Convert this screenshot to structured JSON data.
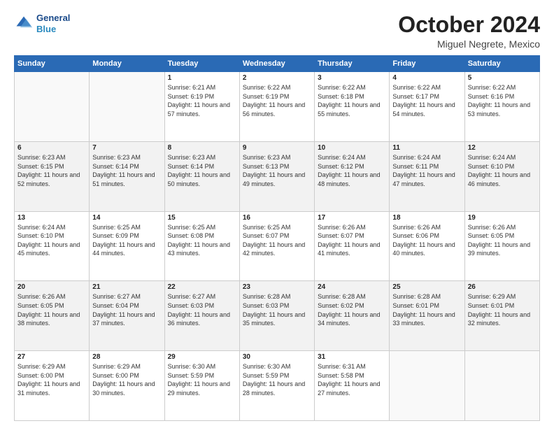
{
  "header": {
    "logo_line1": "General",
    "logo_line2": "Blue",
    "month": "October 2024",
    "location": "Miguel Negrete, Mexico"
  },
  "weekdays": [
    "Sunday",
    "Monday",
    "Tuesday",
    "Wednesday",
    "Thursday",
    "Friday",
    "Saturday"
  ],
  "weeks": [
    [
      {
        "day": "",
        "sunrise": "",
        "sunset": "",
        "daylight": ""
      },
      {
        "day": "",
        "sunrise": "",
        "sunset": "",
        "daylight": ""
      },
      {
        "day": "1",
        "sunrise": "Sunrise: 6:21 AM",
        "sunset": "Sunset: 6:19 PM",
        "daylight": "Daylight: 11 hours and 57 minutes."
      },
      {
        "day": "2",
        "sunrise": "Sunrise: 6:22 AM",
        "sunset": "Sunset: 6:19 PM",
        "daylight": "Daylight: 11 hours and 56 minutes."
      },
      {
        "day": "3",
        "sunrise": "Sunrise: 6:22 AM",
        "sunset": "Sunset: 6:18 PM",
        "daylight": "Daylight: 11 hours and 55 minutes."
      },
      {
        "day": "4",
        "sunrise": "Sunrise: 6:22 AM",
        "sunset": "Sunset: 6:17 PM",
        "daylight": "Daylight: 11 hours and 54 minutes."
      },
      {
        "day": "5",
        "sunrise": "Sunrise: 6:22 AM",
        "sunset": "Sunset: 6:16 PM",
        "daylight": "Daylight: 11 hours and 53 minutes."
      }
    ],
    [
      {
        "day": "6",
        "sunrise": "Sunrise: 6:23 AM",
        "sunset": "Sunset: 6:15 PM",
        "daylight": "Daylight: 11 hours and 52 minutes."
      },
      {
        "day": "7",
        "sunrise": "Sunrise: 6:23 AM",
        "sunset": "Sunset: 6:14 PM",
        "daylight": "Daylight: 11 hours and 51 minutes."
      },
      {
        "day": "8",
        "sunrise": "Sunrise: 6:23 AM",
        "sunset": "Sunset: 6:14 PM",
        "daylight": "Daylight: 11 hours and 50 minutes."
      },
      {
        "day": "9",
        "sunrise": "Sunrise: 6:23 AM",
        "sunset": "Sunset: 6:13 PM",
        "daylight": "Daylight: 11 hours and 49 minutes."
      },
      {
        "day": "10",
        "sunrise": "Sunrise: 6:24 AM",
        "sunset": "Sunset: 6:12 PM",
        "daylight": "Daylight: 11 hours and 48 minutes."
      },
      {
        "day": "11",
        "sunrise": "Sunrise: 6:24 AM",
        "sunset": "Sunset: 6:11 PM",
        "daylight": "Daylight: 11 hours and 47 minutes."
      },
      {
        "day": "12",
        "sunrise": "Sunrise: 6:24 AM",
        "sunset": "Sunset: 6:10 PM",
        "daylight": "Daylight: 11 hours and 46 minutes."
      }
    ],
    [
      {
        "day": "13",
        "sunrise": "Sunrise: 6:24 AM",
        "sunset": "Sunset: 6:10 PM",
        "daylight": "Daylight: 11 hours and 45 minutes."
      },
      {
        "day": "14",
        "sunrise": "Sunrise: 6:25 AM",
        "sunset": "Sunset: 6:09 PM",
        "daylight": "Daylight: 11 hours and 44 minutes."
      },
      {
        "day": "15",
        "sunrise": "Sunrise: 6:25 AM",
        "sunset": "Sunset: 6:08 PM",
        "daylight": "Daylight: 11 hours and 43 minutes."
      },
      {
        "day": "16",
        "sunrise": "Sunrise: 6:25 AM",
        "sunset": "Sunset: 6:07 PM",
        "daylight": "Daylight: 11 hours and 42 minutes."
      },
      {
        "day": "17",
        "sunrise": "Sunrise: 6:26 AM",
        "sunset": "Sunset: 6:07 PM",
        "daylight": "Daylight: 11 hours and 41 minutes."
      },
      {
        "day": "18",
        "sunrise": "Sunrise: 6:26 AM",
        "sunset": "Sunset: 6:06 PM",
        "daylight": "Daylight: 11 hours and 40 minutes."
      },
      {
        "day": "19",
        "sunrise": "Sunrise: 6:26 AM",
        "sunset": "Sunset: 6:05 PM",
        "daylight": "Daylight: 11 hours and 39 minutes."
      }
    ],
    [
      {
        "day": "20",
        "sunrise": "Sunrise: 6:26 AM",
        "sunset": "Sunset: 6:05 PM",
        "daylight": "Daylight: 11 hours and 38 minutes."
      },
      {
        "day": "21",
        "sunrise": "Sunrise: 6:27 AM",
        "sunset": "Sunset: 6:04 PM",
        "daylight": "Daylight: 11 hours and 37 minutes."
      },
      {
        "day": "22",
        "sunrise": "Sunrise: 6:27 AM",
        "sunset": "Sunset: 6:03 PM",
        "daylight": "Daylight: 11 hours and 36 minutes."
      },
      {
        "day": "23",
        "sunrise": "Sunrise: 6:28 AM",
        "sunset": "Sunset: 6:03 PM",
        "daylight": "Daylight: 11 hours and 35 minutes."
      },
      {
        "day": "24",
        "sunrise": "Sunrise: 6:28 AM",
        "sunset": "Sunset: 6:02 PM",
        "daylight": "Daylight: 11 hours and 34 minutes."
      },
      {
        "day": "25",
        "sunrise": "Sunrise: 6:28 AM",
        "sunset": "Sunset: 6:01 PM",
        "daylight": "Daylight: 11 hours and 33 minutes."
      },
      {
        "day": "26",
        "sunrise": "Sunrise: 6:29 AM",
        "sunset": "Sunset: 6:01 PM",
        "daylight": "Daylight: 11 hours and 32 minutes."
      }
    ],
    [
      {
        "day": "27",
        "sunrise": "Sunrise: 6:29 AM",
        "sunset": "Sunset: 6:00 PM",
        "daylight": "Daylight: 11 hours and 31 minutes."
      },
      {
        "day": "28",
        "sunrise": "Sunrise: 6:29 AM",
        "sunset": "Sunset: 6:00 PM",
        "daylight": "Daylight: 11 hours and 30 minutes."
      },
      {
        "day": "29",
        "sunrise": "Sunrise: 6:30 AM",
        "sunset": "Sunset: 5:59 PM",
        "daylight": "Daylight: 11 hours and 29 minutes."
      },
      {
        "day": "30",
        "sunrise": "Sunrise: 6:30 AM",
        "sunset": "Sunset: 5:59 PM",
        "daylight": "Daylight: 11 hours and 28 minutes."
      },
      {
        "day": "31",
        "sunrise": "Sunrise: 6:31 AM",
        "sunset": "Sunset: 5:58 PM",
        "daylight": "Daylight: 11 hours and 27 minutes."
      },
      {
        "day": "",
        "sunrise": "",
        "sunset": "",
        "daylight": ""
      },
      {
        "day": "",
        "sunrise": "",
        "sunset": "",
        "daylight": ""
      }
    ]
  ]
}
